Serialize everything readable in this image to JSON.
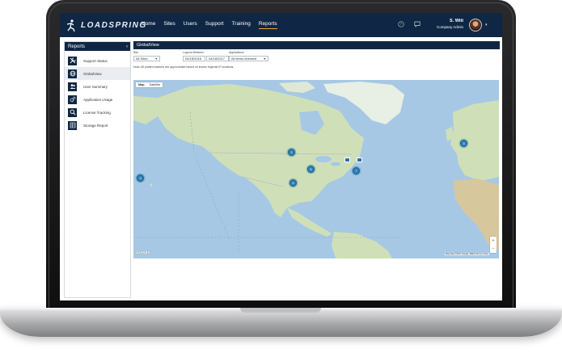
{
  "app": {
    "brand": "LOADSPRING"
  },
  "nav": {
    "items": [
      "Home",
      "Sites",
      "Users",
      "Support",
      "Training",
      "Reports"
    ],
    "active": "Reports"
  },
  "user": {
    "name": "S. Witt",
    "role": "Company Admin"
  },
  "sidebar": {
    "title": "Reports",
    "collapse_glyph": "‹",
    "items": [
      {
        "label": "Support Status",
        "icon": "tools-icon"
      },
      {
        "label": "GlobalView",
        "icon": "globe-icon",
        "active": true
      },
      {
        "label": "User Summary",
        "icon": "users-icon"
      },
      {
        "label": "Application Usage",
        "icon": "gears-icon"
      },
      {
        "label": "License Tracking",
        "icon": "search-icon"
      },
      {
        "label": "Storage Report",
        "icon": "chart-icon"
      }
    ]
  },
  "panel": {
    "title": "GlobalView"
  },
  "filters": {
    "site_label": "Site",
    "site_value": "All Sites",
    "logons_label": "Logons Between",
    "date_from": "04/18/2016",
    "date_to": "04/18/2017",
    "apps_label": "Applications",
    "apps_value": "All items checked",
    "note": "Note: All plotted markers are approximate based on known regional IP locations."
  },
  "map": {
    "tab_map": "Map",
    "tab_satellite": "Satellite",
    "clusters": [
      {
        "count": "3"
      },
      {
        "count": "2"
      },
      {
        "count": "5"
      },
      {
        "count": "7"
      },
      {
        "count": "4"
      },
      {
        "count": "3"
      }
    ],
    "zoom_in": "+",
    "zoom_out": "−",
    "google_logo": "Google",
    "attribution": "Map data ©2017 Google, INEGI   Terms of Use"
  },
  "colors": {
    "nav_bg": "#0f2744",
    "accent": "#f0a830",
    "cluster": "#2f7fb3",
    "water": "#a6c8e5",
    "land": "#cfe0b8"
  }
}
